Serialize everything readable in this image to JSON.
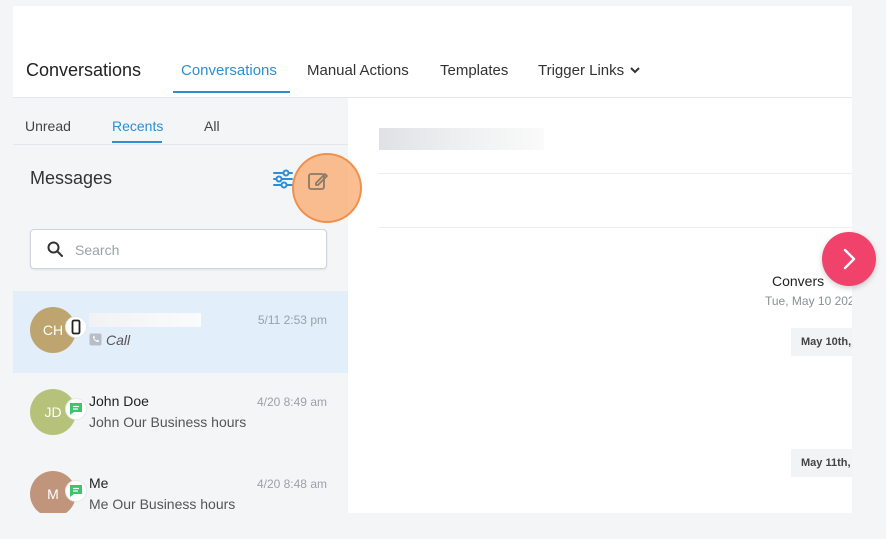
{
  "header": {
    "title": "Conversations",
    "tabs": [
      {
        "label": "Conversations"
      },
      {
        "label": "Manual Actions"
      },
      {
        "label": "Templates"
      },
      {
        "label": "Trigger Links"
      }
    ]
  },
  "left_panel": {
    "subtabs": [
      {
        "label": "Unread"
      },
      {
        "label": "Recents"
      },
      {
        "label": "All"
      }
    ],
    "messages_title": "Messages",
    "search": {
      "placeholder": "Search",
      "value": ""
    },
    "conversations": [
      {
        "initials": "CH",
        "avatar_color": "#bea56f",
        "name": "",
        "preview": "Call",
        "time": "5/11 2:53 pm",
        "channel": "phone-icon",
        "selected": true
      },
      {
        "initials": "JD",
        "avatar_color": "#b6c27a",
        "name": "John Doe",
        "preview": "John Our Business hours",
        "time": "4/20 8:49 am",
        "channel": "chat-icon",
        "selected": false
      },
      {
        "initials": "M",
        "avatar_color": "#c0957c",
        "name": "Me",
        "preview": "Me Our Business hours",
        "time": "4/20 8:48 am",
        "channel": "chat-icon",
        "selected": false
      }
    ]
  },
  "right_panel": {
    "conversation_start_title": "Convers",
    "conversation_start_date": "Tue, May 10 202",
    "date_pills": [
      "May 10th,",
      "May 11th,"
    ]
  },
  "colors": {
    "accent": "#2d8ed3",
    "fab": "#f1426b",
    "chat_badge": "#3ec46d"
  }
}
